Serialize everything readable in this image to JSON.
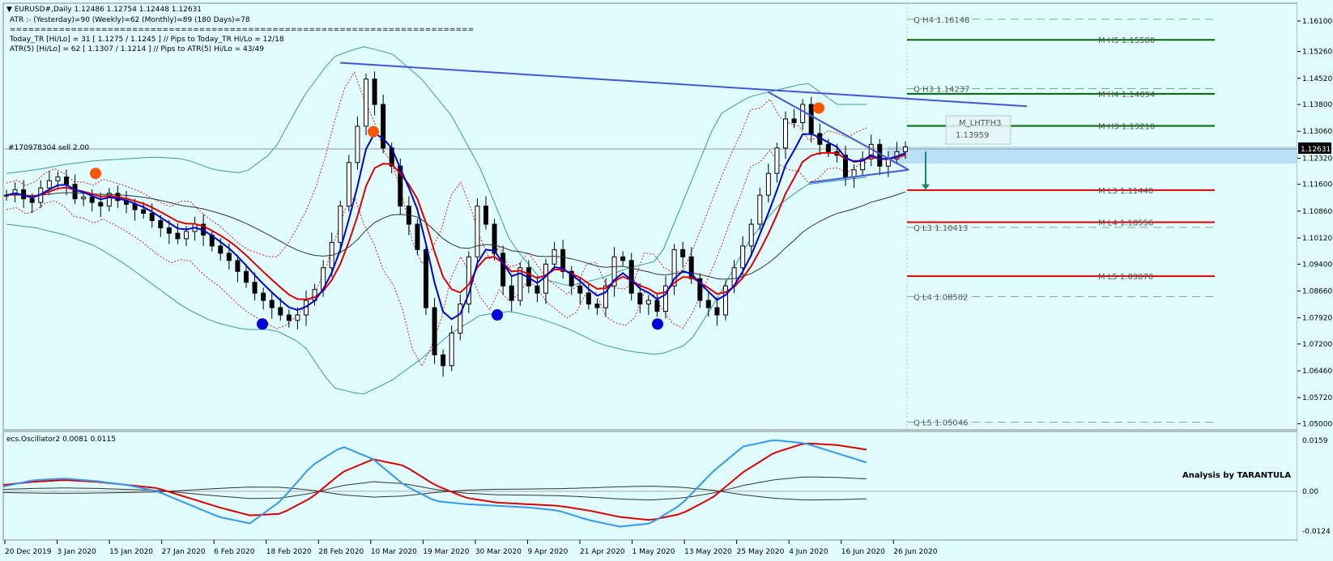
{
  "header": {
    "line1": "▼ EURUSD#,Daily  1.12486 1.12754 1.12448 1.12631",
    "line2": "ATR :- (Yesterday)=90       (Weekly)=62       (Monthly)=89       (180 Days)=78",
    "line3": "============================================================================",
    "line4": "Today_TR [Hi/Lo] = 31 [ 1.1275 / 1.1245 ]  // Pips to Today_TR Hi/Lo  =  12/18",
    "line5": "ATR(5)       [Hi/Lo] = 62 [ 1.1307 / 1.1214 ]  //  Pips to ATR(5) Hi/Lo      =  43/49"
  },
  "order_label": "#170978304 sell 2.00",
  "price_tag": "1.12631",
  "indicator_label": "ecs.Oscillator2 0.0081 0.0115",
  "banner": "Analysis by TARANTULA",
  "pivots": [
    {
      "label": "Q  H4 1.16148",
      "price": 1.16148,
      "color": "#33aa33",
      "dashed": true,
      "label_side": "left"
    },
    {
      "label": "M  H5 1.15580",
      "price": 1.1558,
      "color": "#006600",
      "dashed": false,
      "label_side": "right"
    },
    {
      "label": "Q  H3 1.14237",
      "price": 1.14237,
      "color": "#33aa33",
      "dashed": true,
      "label_side": "left"
    },
    {
      "label": "M  H4 1.14094",
      "price": 1.14094,
      "color": "#006600",
      "dashed": false,
      "label_side": "right"
    },
    {
      "label": "M  H3 1.13210",
      "price": 1.1321,
      "color": "#006600",
      "dashed": false,
      "label_side": "right"
    },
    {
      "label": "M  L3 1.11440",
      "price": 1.1144,
      "color": "#dd0000",
      "dashed": false,
      "label_side": "right"
    },
    {
      "label": "M  L4 1.10556",
      "price": 1.10556,
      "color": "#dd0000",
      "dashed": false,
      "label_side": "right"
    },
    {
      "label": "Q  L3 1.10413",
      "price": 1.10413,
      "color": "#777777",
      "dashed": true,
      "label_side": "left"
    },
    {
      "label": "M  L5 1.09070",
      "price": 1.0907,
      "color": "#dd0000",
      "dashed": false,
      "label_side": "right"
    },
    {
      "label": "Q  L4 1.08502",
      "price": 1.08502,
      "color": "#777777",
      "dashed": true,
      "label_side": "left"
    },
    {
      "label": "Q  L5 1.05046",
      "price": 1.05046,
      "color": "#777777",
      "dashed": true,
      "label_side": "left"
    }
  ],
  "overlay_box": {
    "line1": "M_LHTFH3",
    "line2": "1.13959"
  },
  "chart_data": {
    "type": "candlestick",
    "title": "EURUSD#,Daily",
    "ylim": [
      1.049,
      1.165
    ],
    "y_ticks": [
      "1.16100",
      "1.15260",
      "1.14520",
      "1.13800",
      "1.13060",
      "1.12320",
      "1.11600",
      "1.10860",
      "1.10120",
      "1.09400",
      "1.08660",
      "1.07920",
      "1.07200",
      "1.06460",
      "1.05720",
      "1.05000"
    ],
    "x_ticks": [
      "20 Dec 2019",
      "3 Jan 2020",
      "15 Jan 2020",
      "27 Jan 2020",
      "6 Feb 2020",
      "18 Feb 2020",
      "28 Feb 2020",
      "10 Mar 2020",
      "19 Mar 2020",
      "30 Mar 2020",
      "9 Apr 2020",
      "21 Apr 2020",
      "1 May 2020",
      "13 May 2020",
      "25 May 2020",
      "4 Jun 2020",
      "16 Jun 2020",
      "26 Jun 2020"
    ],
    "close_path": [
      1.113,
      1.1145,
      1.112,
      1.111,
      1.115,
      1.117,
      1.118,
      1.116,
      1.112,
      1.1125,
      1.111,
      1.11,
      1.1135,
      1.1115,
      1.1105,
      1.109,
      1.108,
      1.106,
      1.104,
      1.1025,
      1.101,
      1.103,
      1.105,
      1.102,
      1.099,
      1.097,
      1.095,
      1.092,
      1.089,
      1.086,
      1.084,
      1.082,
      1.08,
      1.0785,
      1.08,
      1.084,
      1.087,
      1.093,
      1.1,
      1.11,
      1.122,
      1.132,
      1.145,
      1.138,
      1.126,
      1.121,
      1.11,
      1.105,
      1.098,
      1.082,
      1.069,
      1.066,
      1.075,
      1.083,
      1.096,
      1.11,
      1.105,
      1.097,
      1.088,
      1.084,
      1.093,
      1.088,
      1.086,
      1.094,
      1.098,
      1.092,
      1.088,
      1.086,
      1.083,
      1.082,
      1.088,
      1.096,
      1.095,
      1.086,
      1.083,
      1.084,
      1.081,
      1.088,
      1.098,
      1.096,
      1.09,
      1.084,
      1.082,
      1.08,
      1.088,
      1.093,
      1.099,
      1.105,
      1.113,
      1.119,
      1.126,
      1.134,
      1.133,
      1.138,
      1.13,
      1.127,
      1.125,
      1.124,
      1.118,
      1.12,
      1.123,
      1.127,
      1.121,
      1.123,
      1.125,
      1.1263
    ],
    "upper_band_path": [
      1.119,
      1.12,
      1.1215,
      1.1225,
      1.123,
      1.1235,
      1.123,
      1.12,
      1.119,
      1.125,
      1.14,
      1.151,
      1.154,
      1.152,
      1.145,
      1.135,
      1.12,
      1.1,
      1.09,
      1.088,
      1.09,
      1.093,
      1.095,
      1.115,
      1.135,
      1.14,
      1.142,
      1.144,
      1.138,
      1.138
    ],
    "lower_band_path": [
      1.105,
      1.104,
      1.102,
      1.099,
      1.094,
      1.088,
      1.082,
      1.078,
      1.076,
      1.076,
      1.072,
      1.06,
      1.058,
      1.062,
      1.068,
      1.075,
      1.08,
      1.081,
      1.079,
      1.076,
      1.072,
      1.07,
      1.069,
      1.072,
      1.085,
      1.1,
      1.11,
      1.116,
      1.117,
      1.118
    ],
    "osc_ylim": [
      -0.0134,
      0.0169
    ],
    "osc_ticks": [
      "0.0159",
      "0.00",
      "-0.0124"
    ],
    "osc_blue_path": [
      0.0015,
      0.0035,
      0.004,
      0.0032,
      0.002,
      0.0,
      -0.004,
      -0.008,
      -0.01,
      -0.003,
      0.008,
      0.014,
      0.01,
      0.002,
      -0.003,
      -0.004,
      -0.0045,
      -0.005,
      -0.006,
      -0.009,
      -0.011,
      -0.01,
      -0.004,
      0.006,
      0.014,
      0.016,
      0.015,
      0.012,
      0.009
    ],
    "osc_red_path": [
      0.002,
      0.003,
      0.0035,
      0.003,
      0.002,
      0.001,
      -0.002,
      -0.005,
      -0.0075,
      -0.007,
      -0.002,
      0.006,
      0.01,
      0.008,
      0.002,
      -0.002,
      -0.0035,
      -0.004,
      -0.0045,
      -0.006,
      -0.008,
      -0.009,
      -0.007,
      -0.002,
      0.006,
      0.012,
      0.015,
      0.0145,
      0.013
    ],
    "colors": {
      "bull": "#ffffff",
      "bear": "#000000",
      "fast_ma": "#0000cc",
      "slow_ma": "#dd0000",
      "band": "#3a9a9a",
      "trend": "#4455dd",
      "osc_blue": "#3399ee",
      "osc_red": "#dd0000",
      "sell_dot": "#ff5500",
      "buy_dot": "#0000dd"
    }
  }
}
